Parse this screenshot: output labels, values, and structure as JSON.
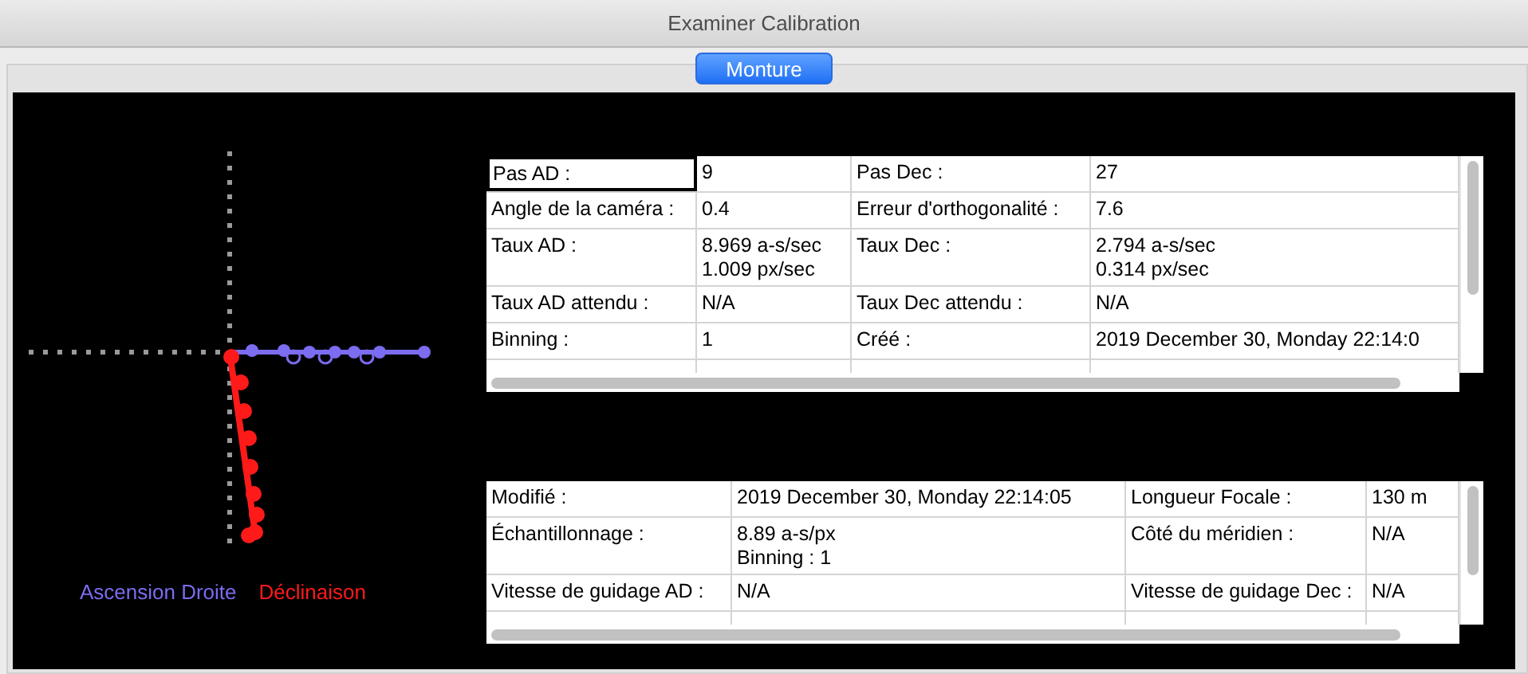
{
  "window": {
    "title": "Examiner Calibration"
  },
  "tabs": [
    {
      "label": "Monture",
      "selected": true
    }
  ],
  "plot": {
    "legend": [
      {
        "label": "Ascension Droite",
        "color": "#7b6cf0"
      },
      {
        "label": "Déclinaison",
        "color": "#ff1a1a"
      }
    ]
  },
  "tables": [
    {
      "rows": [
        [
          {
            "text": "Pas AD :",
            "selected": true
          },
          {
            "text": "9",
            "selected": false
          },
          {
            "text": "Pas Dec :",
            "selected": false
          },
          {
            "text": "27",
            "selected": false
          }
        ],
        [
          {
            "text": "Angle de la caméra :",
            "selected": false
          },
          {
            "text": "0.4",
            "selected": false
          },
          {
            "text": "Erreur d'orthogonalité :",
            "selected": false
          },
          {
            "text": "7.6",
            "selected": false
          }
        ],
        [
          {
            "text": "Taux AD :",
            "selected": false
          },
          {
            "text": "8.969 a-s/sec\n1.009 px/sec",
            "selected": false
          },
          {
            "text": "Taux Dec :",
            "selected": false
          },
          {
            "text": "2.794 a-s/sec\n0.314 px/sec",
            "selected": false
          }
        ],
        [
          {
            "text": "Taux AD attendu :",
            "selected": false
          },
          {
            "text": "N/A",
            "selected": false
          },
          {
            "text": "Taux Dec attendu :",
            "selected": false
          },
          {
            "text": "N/A",
            "selected": false
          }
        ],
        [
          {
            "text": "Binning :",
            "selected": false
          },
          {
            "text": "1",
            "selected": false
          },
          {
            "text": "Créé :",
            "selected": false
          },
          {
            "text": "2019 December 30, Monday 22:14:0",
            "selected": false
          }
        ]
      ]
    },
    {
      "rows": [
        [
          {
            "text": "Modifié :",
            "selected": false
          },
          {
            "text": "2019 December 30, Monday 22:14:05",
            "selected": false
          },
          {
            "text": "Longueur Focale :",
            "selected": false
          },
          {
            "text": "130 m",
            "selected": false
          }
        ],
        [
          {
            "text": "Échantillonnage :",
            "selected": false
          },
          {
            "text": "8.89 a-s/px\nBinning : 1",
            "selected": false
          },
          {
            "text": "Côté du méridien :",
            "selected": false
          },
          {
            "text": "N/A",
            "selected": false
          }
        ],
        [
          {
            "text": "Vitesse de guidage AD :",
            "selected": false
          },
          {
            "text": "N/A",
            "selected": false
          },
          {
            "text": "Vitesse de guidage Dec :",
            "selected": false
          },
          {
            "text": "N/A",
            "selected": false
          }
        ]
      ]
    }
  ]
}
